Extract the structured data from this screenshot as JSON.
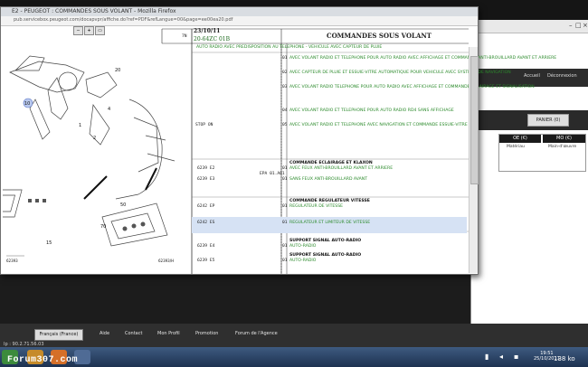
{
  "popup": {
    "title": "E2 - PEUGEOT : COMMANDES SOUS VOLANT - Mozilla Firefox",
    "url": "pub.servicebox.peugeot.com/docapvpr/affiche.do?ref=PDF&refLangue=00&page=ee00ea20.pdf",
    "header": {
      "date": "23/10/11",
      "ref_small": "7N",
      "ref_code": "20-64ZC 01B",
      "title": "COMMANDES SOUS VOLANT"
    },
    "green_header": "AUTO RADIO AVEC PREDISPOSITION AU TELEPHONE - VEHICULE AVEC CAPTEUR DE PLUIE",
    "rows": [
      {
        "code": "",
        "ref": "01",
        "text": "AVEC VOLANT RADIO ET TELEPHONE POUR AUTO RADIO AVEC AFFICHAGE ET COMMANDE ANTI-BROUILLARD AVANT ET ARRIERE"
      },
      {
        "code": "",
        "ref": "02",
        "text": "AVEC CAPTEUR DE PLUIE ET ESSUIE-VITRE AUTOMATIQUE POUR VEHICULE AVEC SYSTEME DE NAVIGATION"
      },
      {
        "code": "",
        "ref": "03",
        "text": "AVEC VOLANT RADIO TELEPHONE POUR AUTO RADIO AVEC AFFICHAGE ET COMMANDE ECLAIRAGE ET SIGNALISATION"
      },
      {
        "code": "",
        "ref": "04",
        "text": "AVEC VOLANT RADIO ET TELEPHONE POUR AUTO RADIO RD4 SANS AFFICHAGE"
      },
      {
        "code": "",
        "ref": "05",
        "text": "AVEC VOLANT RADIO ET TELEPHONE AVEC NAVIGATION ET COMMANDE ESSUIE-VITRE"
      }
    ],
    "section1": "COMMANDE ECLAIRAGE ET KLAXON",
    "section1_rows": [
      {
        "code": "6239 E2",
        "ref": "01",
        "text": "AVEC FEUX ANTI-BROUILLARD AVANT ET ARRIERE"
      },
      {
        "code": "6239 E3",
        "ref": "01",
        "text": "SANS FEUX ANTI-BROUILLARD AVANT"
      }
    ],
    "section2": "COMMANDE REGULATEUR VITESSE",
    "section2_rows": [
      {
        "code": "6242 EP",
        "ref": "01",
        "text": "REGULATEUR DE VITESSE"
      },
      {
        "code": "6242 ES",
        "ref": "01",
        "text": "REGULATEUR ET LIMITEUR DE VITESSE"
      }
    ],
    "section3": "SUPPORT SIGNAL AUTO-RADIO",
    "section3_rows": [
      {
        "code": "6239 E4",
        "ref": "01",
        "text": "AUTO-RADIO"
      },
      {
        "code": "6239 E5",
        "ref": "01",
        "text": "AUTO-RADIO"
      }
    ],
    "left_note": "STOP ON",
    "mid_note": "EPA 01.A01",
    "callouts": [
      "20",
      "10",
      "1",
      "4",
      "2",
      "70",
      "15",
      "50"
    ],
    "diagram_code_left": "62393",
    "diagram_code_right": "62393/H"
  },
  "browser_right": {
    "accueil": "Accueil",
    "deconnexion": "Déconnexion",
    "cart_label": "PANIER (0)",
    "grid_head": [
      "OE (€)",
      "MO (€)"
    ],
    "grid_vals": [
      "Matériau",
      "Main-d'œuvre"
    ]
  },
  "footer": {
    "language": "Français (France)",
    "links": [
      "Aide",
      "Contact",
      "Mon Profil",
      "Promotion",
      "Forum de l'Agence"
    ],
    "ip": "Ip : 90.2.71.56.03"
  },
  "taskbar": {
    "watermark": "Forum307.com",
    "kbps": "138 ko",
    "time": "19:51",
    "date": "25/10/2011"
  }
}
